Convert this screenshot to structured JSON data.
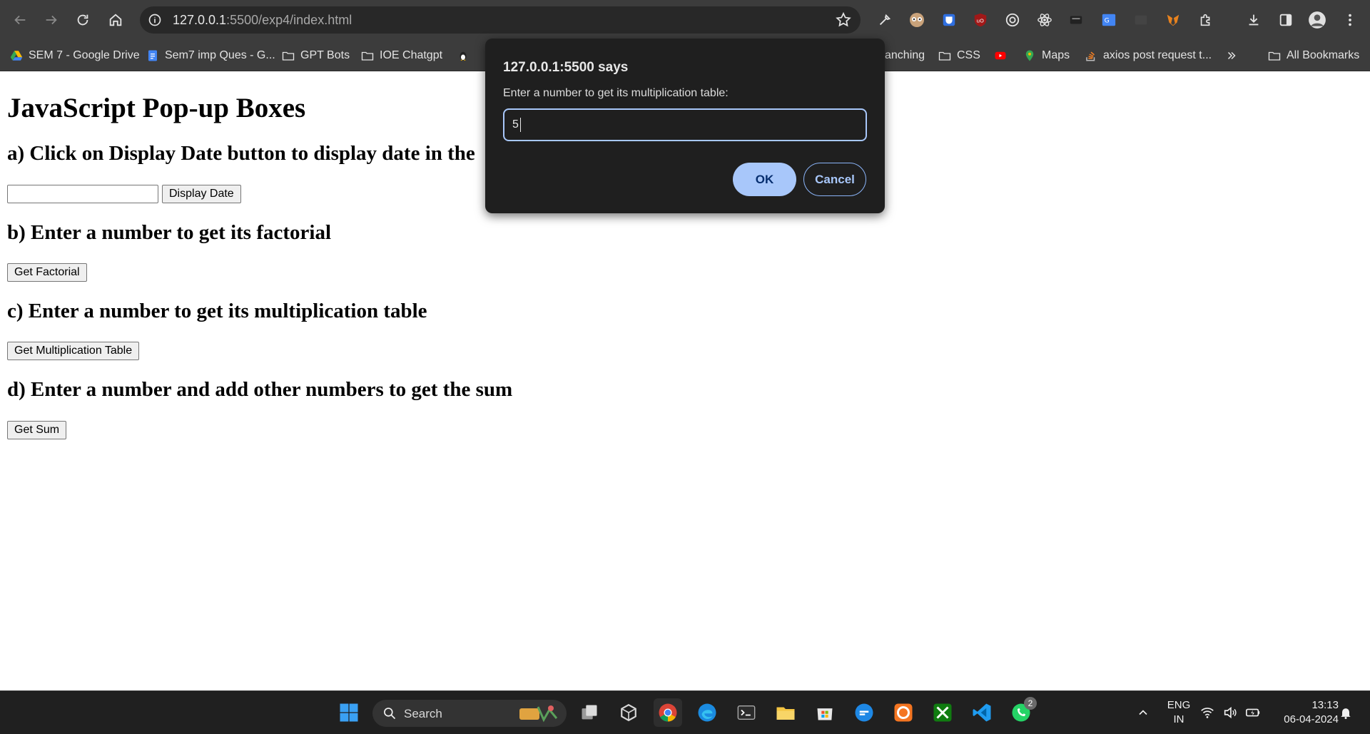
{
  "browser": {
    "url_host": "127.0.0.1",
    "url_rest": ":5500/exp4/index.html"
  },
  "bookmarks": [
    {
      "label": "SEM 7 - Google Drive",
      "icon": "google-drive-icon"
    },
    {
      "label": "Sem7 imp Ques - G...",
      "icon": "google-docs-icon"
    },
    {
      "label": "GPT Bots",
      "icon": "folder-icon"
    },
    {
      "label": "IOE Chatgpt",
      "icon": "folder-icon"
    },
    {
      "label": "anching",
      "icon": ""
    },
    {
      "label": "CSS",
      "icon": "folder-icon"
    },
    {
      "label": "Maps",
      "icon": "maps-icon"
    },
    {
      "label": "axios post request t...",
      "icon": "stackoverflow-icon"
    },
    {
      "label": "All Bookmarks",
      "icon": "folder-icon"
    }
  ],
  "page": {
    "title": "JavaScript Pop-up Boxes",
    "section_a": "a) Click on Display Date button to display date in the",
    "display_date_button": "Display Date",
    "section_b": "b) Enter a number to get its factorial",
    "factorial_button": "Get Factorial",
    "section_c": "c) Enter a number to get its multiplication table",
    "multiplication_button": "Get Multiplication Table",
    "section_d": "d) Enter a number and add other numbers to get the sum",
    "sum_button": "Get Sum"
  },
  "dialog": {
    "title": "127.0.0.1:5500 says",
    "message": "Enter a number to get its multiplication table:",
    "input_value": "5",
    "ok_label": "OK",
    "cancel_label": "Cancel"
  },
  "taskbar": {
    "search_label": "Search",
    "lang_line1": "ENG",
    "lang_line2": "IN",
    "time": "13:13",
    "date": "06-04-2024",
    "whatsapp_badge": "2"
  },
  "colors": {
    "chrome_bg": "#3c3c3c",
    "dialog_bg": "#1f1f1f",
    "accent": "#a8c7fa",
    "taskbar_bg": "#202020"
  }
}
